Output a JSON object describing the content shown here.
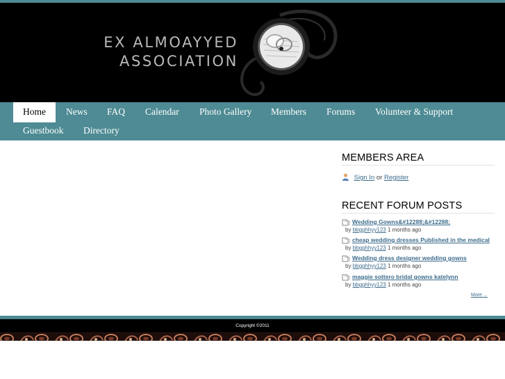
{
  "site": {
    "title_line1": "EX ALMOAYYED",
    "title_line2": "ASSOCIATION"
  },
  "nav": {
    "items": [
      {
        "label": "Home",
        "active": true
      },
      {
        "label": "News"
      },
      {
        "label": "FAQ"
      },
      {
        "label": "Calendar"
      },
      {
        "label": "Photo Gallery"
      },
      {
        "label": "Members"
      },
      {
        "label": "Forums"
      },
      {
        "label": "Volunteer & Support"
      },
      {
        "label": "Guestbook"
      },
      {
        "label": "Directory"
      }
    ]
  },
  "members_area": {
    "title": "MEMBERS AREA",
    "sign_in": "Sign In",
    "or": "or",
    "register": "Register",
    "icon": "user-icon"
  },
  "forum": {
    "title": "RECENT FORUM POSTS",
    "by": "by",
    "posts": [
      {
        "title": "Wedding Gowns&#12288;&#12288;",
        "author": "bbgghhyy123",
        "time": "1 months ago"
      },
      {
        "title": "cheap wedding dresses Published in the medical",
        "author": "bbgghhyy123",
        "time": "1 months ago"
      },
      {
        "title": "Wedding dress designer wedding gowns",
        "author": "bbgghhyy123",
        "time": "1 months ago"
      },
      {
        "title": "maggie sottero bridal gowns katelynn",
        "author": "bbgghhyy123",
        "time": "1 months ago"
      }
    ],
    "more": "More ..."
  },
  "footer": {
    "copyright": "Copyright ©2011"
  },
  "colors": {
    "accent": "#4e8b94",
    "header_bg": "#000000",
    "link": "#3c6c8c"
  }
}
